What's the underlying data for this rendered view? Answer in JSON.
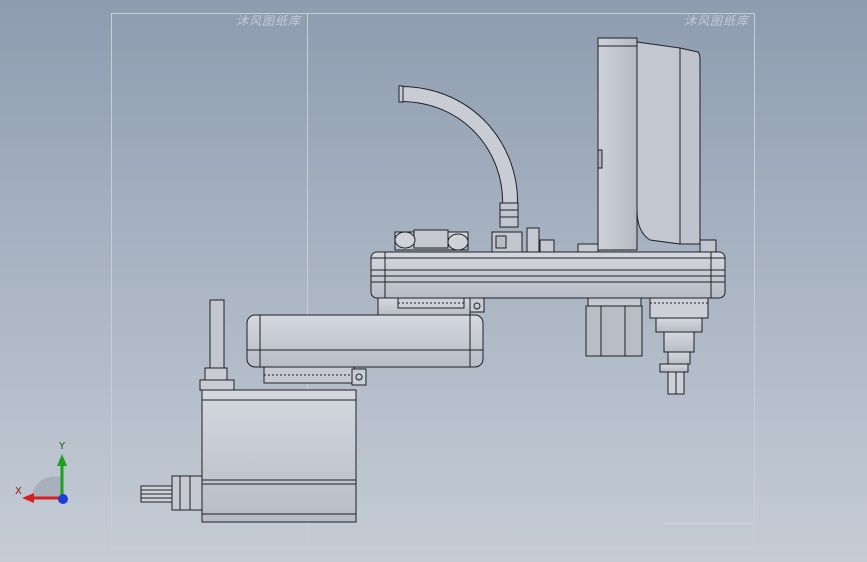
{
  "watermarks": {
    "left": "沐风图纸库",
    "right": "沐风图纸库"
  },
  "triad": {
    "x_label": "X",
    "y_label": "Y",
    "colors": {
      "x": "#d62020",
      "y": "#1ea01e",
      "z": "#1e3fd6"
    }
  },
  "colors": {
    "background_top": "#8e9cb0",
    "background_bottom": "#c5ccd6",
    "part_fill": "#c7cad3",
    "part_light": "#dcdee4",
    "part_stroke": "#202226"
  },
  "icons": {
    "coordinate_triad": "triad-icon"
  }
}
